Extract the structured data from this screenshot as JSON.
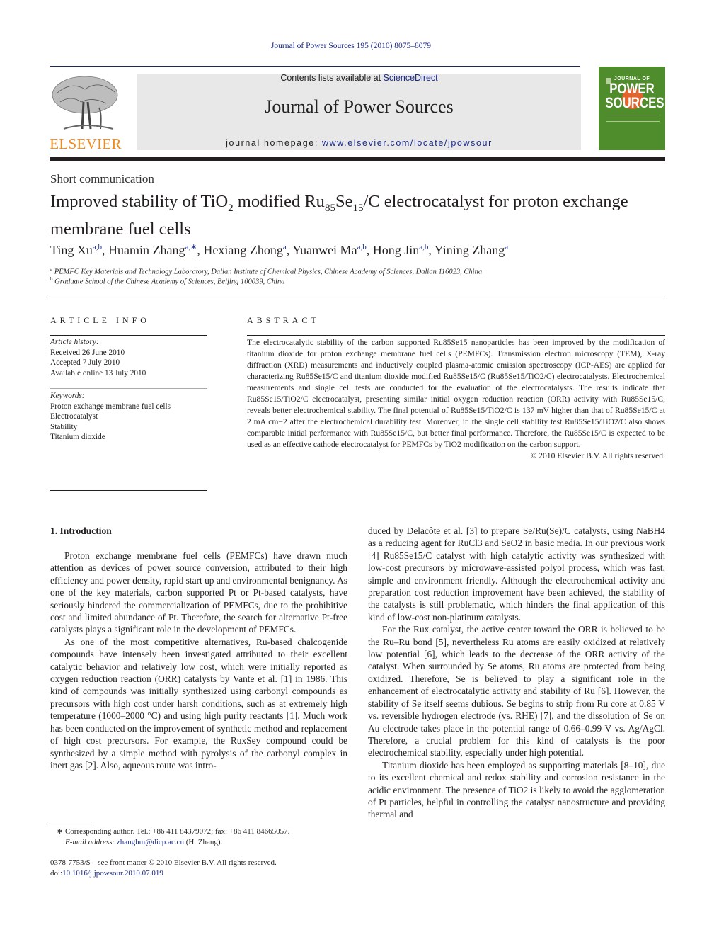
{
  "header": {
    "running_citation": "Journal of Power Sources 195 (2010) 8075–8079",
    "contents_prefix": "Contents lists available at ",
    "contents_link": "ScienceDirect",
    "journal_title": "Journal of Power Sources",
    "homepage_prefix": "journal homepage: ",
    "homepage_url": "www.elsevier.com/locate/jpowsour",
    "publisher_logo": "ELSEVIER",
    "cover": {
      "line1": "JOURNAL OF",
      "line2": "POWER",
      "line3": "SOURCES",
      "bg_color": "#4f8c2c",
      "accent_color": "#e2632b"
    }
  },
  "article": {
    "type": "Short communication",
    "title_parts": [
      "Improved stability of TiO",
      "2",
      " modified Ru",
      "85",
      "Se",
      "15",
      "/C electrocatalyst for proton exchange membrane fuel cells"
    ],
    "authors": [
      {
        "name": "Ting Xu",
        "sup": "a,b"
      },
      {
        "name": "Huamin Zhang",
        "sup": "a,∗"
      },
      {
        "name": "Hexiang Zhong",
        "sup": "a"
      },
      {
        "name": "Yuanwei Ma",
        "sup": "a,b"
      },
      {
        "name": "Hong Jin",
        "sup": "a,b"
      },
      {
        "name": "Yining Zhang",
        "sup": "a"
      }
    ],
    "affiliations": [
      {
        "key": "a",
        "text": "PEMFC Key Materials and Technology Laboratory, Dalian Institute of Chemical Physics, Chinese Academy of Sciences, Dalian 116023, China"
      },
      {
        "key": "b",
        "text": "Graduate School of the Chinese Academy of Sciences, Beijing 100039, China"
      }
    ]
  },
  "article_info": {
    "heading": "ARTICLE INFO",
    "history_label": "Article history:",
    "history": [
      "Received 26 June 2010",
      "Accepted 7 July 2010",
      "Available online 13 July 2010"
    ],
    "keywords_label": "Keywords:",
    "keywords": [
      "Proton exchange membrane fuel cells",
      "Electrocatalyst",
      "Stability",
      "Titanium dioxide"
    ]
  },
  "abstract": {
    "heading": "ABSTRACT",
    "text": "The electrocatalytic stability of the carbon supported Ru85Se15 nanoparticles has been improved by the modification of titanium dioxide for proton exchange membrane fuel cells (PEMFCs). Transmission electron microscopy (TEM), X-ray diffraction (XRD) measurements and inductively coupled plasma-atomic emission spectroscopy (ICP-AES) are applied for characterizing Ru85Se15/C and titanium dioxide modified Ru85Se15/C (Ru85Se15/TiO2/C) electrocatalysts. Electrochemical measurements and single cell tests are conducted for the evaluation of the electrocatalysts. The results indicate that Ru85Se15/TiO2/C electrocatalyst, presenting similar initial oxygen reduction reaction (ORR) activity with Ru85Se15/C, reveals better electrochemical stability. The final potential of Ru85Se15/TiO2/C is 137 mV higher than that of Ru85Se15/C at 2 mA cm−2 after the electrochemical durability test. Moreover, in the single cell stability test Ru85Se15/TiO2/C also shows comparable initial performance with Ru85Se15/C, but better final performance. Therefore, the Ru85Se15/C is expected to be used as an effective cathode electrocatalyst for PEMFCs by TiO2 modification on the carbon support.",
    "copyright": "© 2010 Elsevier B.V. All rights reserved."
  },
  "body": {
    "section_heading": "1.  Introduction",
    "left_paragraphs": [
      "Proton exchange membrane fuel cells (PEMFCs) have drawn much attention as devices of power source conversion, attributed to their high efficiency and power density, rapid start up and environmental benignancy. As one of the key materials, carbon supported Pt or Pt-based catalysts, have seriously hindered the commercialization of PEMFCs, due to the prohibitive cost and limited abundance of Pt. Therefore, the search for alternative Pt-free catalysts plays a significant role in the development of PEMFCs.",
      "As one of the most competitive alternatives, Ru-based chalcogenide compounds have intensely been investigated attributed to their excellent catalytic behavior and relatively low cost, which were initially reported as oxygen reduction reaction (ORR) catalysts by Vante et al. [1] in 1986. This kind of compounds was initially synthesized using carbonyl compounds as precursors with high cost under harsh conditions, such as at extremely high temperature (1000–2000 °C) and using high purity reactants [1]. Much work has been conducted on the improvement of synthetic method and replacement of high cost precursors. For example, the RuxSey compound could be synthesized by a simple method with pyrolysis of the carbonyl complex in inert gas [2]. Also, aqueous route was intro-"
    ],
    "right_paragraphs": [
      "duced by Delacôte et al. [3] to prepare Se/Ru(Se)/C catalysts, using NaBH4 as a reducing agent for RuCl3 and SeO2 in basic media. In our previous work [4] Ru85Se15/C catalyst with high catalytic activity was synthesized with low-cost precursors by microwave-assisted polyol process, which was fast, simple and environment friendly. Although the electrochemical activity and preparation cost reduction improvement have been achieved, the stability of the catalysts is still problematic, which hinders the final application of this kind of low-cost non-platinum catalysts.",
      "For the Rux catalyst, the active center toward the ORR is believed to be the Ru–Ru bond [5], nevertheless Ru atoms are easily oxidized at relatively low potential [6], which leads to the decrease of the ORR activity of the catalyst. When surrounded by Se atoms, Ru atoms are protected from being oxidized. Therefore, Se is believed to play a significant role in the enhancement of electrocatalytic activity and stability of Ru [6]. However, the stability of Se itself seems dubious. Se begins to strip from Ru core at 0.85 V vs. reversible hydrogen electrode (vs. RHE) [7], and the dissolution of Se on Au electrode takes place in the potential range of 0.66–0.99 V vs. Ag/AgCl. Therefore, a crucial problem for this kind of catalysts is the poor electrochemical stability, especially under high potential.",
      "Titanium dioxide has been employed as supporting materials [8–10], due to its excellent chemical and redox stability and corrosion resistance in the acidic environment. The presence of TiO2 is likely to avoid the agglomeration of Pt particles, helpful in controlling the catalyst nanostructure and providing thermal and"
    ]
  },
  "footnotes": {
    "corresponding": "∗ Corresponding author. Tel.: +86 411 84379072; fax: +86 411 84665057.",
    "email_label": "E-mail address:",
    "email": "zhanghm@dicp.ac.cn",
    "email_suffix": " (H. Zhang).",
    "issn": "0378-7753/$ – see front matter © 2010 Elsevier B.V. All rights reserved.",
    "doi_prefix": "doi:",
    "doi": "10.1016/j.jpowsour.2010.07.019"
  },
  "colors": {
    "link": "#1a2a8a",
    "elsevier_orange": "#f08a1c",
    "banner_gray": "#e8e8e9"
  }
}
